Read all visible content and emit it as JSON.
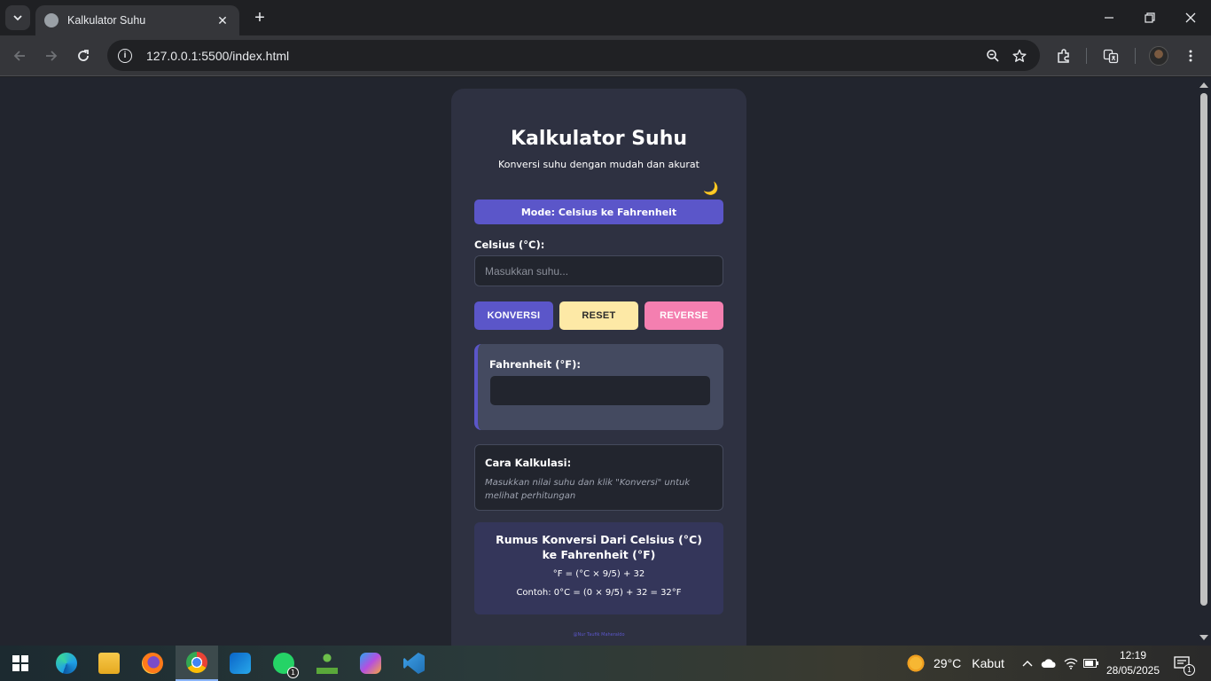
{
  "browser": {
    "tab_title": "Kalkulator Suhu",
    "url": "127.0.0.1:5500/index.html",
    "close_glyph": "✕",
    "new_tab_glyph": "+"
  },
  "app": {
    "title": "Kalkulator Suhu",
    "subtitle": "Konversi suhu dengan mudah dan akurat",
    "theme_toggle_glyph": "🌙",
    "mode_label": "Mode: Celsius ke Fahrenheit",
    "input_label": "Celsius (°C):",
    "input_placeholder": "Masukkan suhu...",
    "input_value": "",
    "buttons": {
      "convert": "KONVERSI",
      "reset": "RESET",
      "reverse": "REVERSE"
    },
    "result_label": "Fahrenheit (°F):",
    "result_value": "",
    "calc": {
      "title": "Cara Kalkulasi:",
      "description": "Masukkan nilai suhu dan klik \"Konversi\" untuk melihat perhitungan"
    },
    "formula": {
      "title": "Rumus Konversi Dari Celsius (°C) ke Fahrenheit (°F)",
      "equation": "°F = (°C × 9/5) + 32",
      "example": "Contoh: 0°C = (0 × 9/5) + 32 = 32°F"
    },
    "footer": "@Nur Taufik Maheraldo"
  },
  "taskbar": {
    "weather_temp": "29°C",
    "weather_condition": "Kabut",
    "time": "12:19",
    "date": "28/05/2025",
    "whatsapp_badge": "1",
    "notification_badge": "1"
  },
  "colors": {
    "accent": "#5b56c9",
    "reset": "#fde9a6",
    "reverse": "#f47fb0",
    "card": "#2e3141",
    "page_bg": "#22252e"
  }
}
